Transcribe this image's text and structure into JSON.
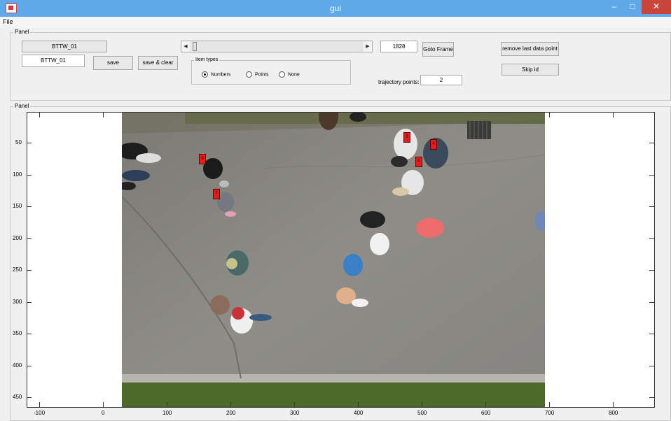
{
  "window": {
    "title": "gui"
  },
  "menu": {
    "file": "File"
  },
  "control_panel": {
    "title": "Panel",
    "name_display": "BTTW_01",
    "name_input": "BTTW_01",
    "save": "save",
    "save_clear": "save & clear",
    "frame_input": "1828",
    "goto_frame": "Goto Frame",
    "remove_last": "remove last data point",
    "skip_id": "Skip id",
    "item_types": {
      "title": "Item types",
      "options": [
        "Numbers",
        "Points",
        "None"
      ],
      "selected": "Numbers"
    },
    "trajectory_label": "trajectory points:",
    "trajectory_value": "2"
  },
  "image_panel": {
    "title": "Panel",
    "x_ticks": [
      "-100",
      "0",
      "100",
      "200",
      "300",
      "400",
      "500",
      "600",
      "700",
      "800"
    ],
    "y_ticks": [
      "50",
      "100",
      "150",
      "200",
      "250",
      "300",
      "350",
      "400",
      "450"
    ]
  },
  "markers": [
    "3",
    "4",
    "5",
    "6",
    "7"
  ],
  "colors": {
    "marker": "#e41c1c",
    "titlebar": "#5fa9e9"
  }
}
